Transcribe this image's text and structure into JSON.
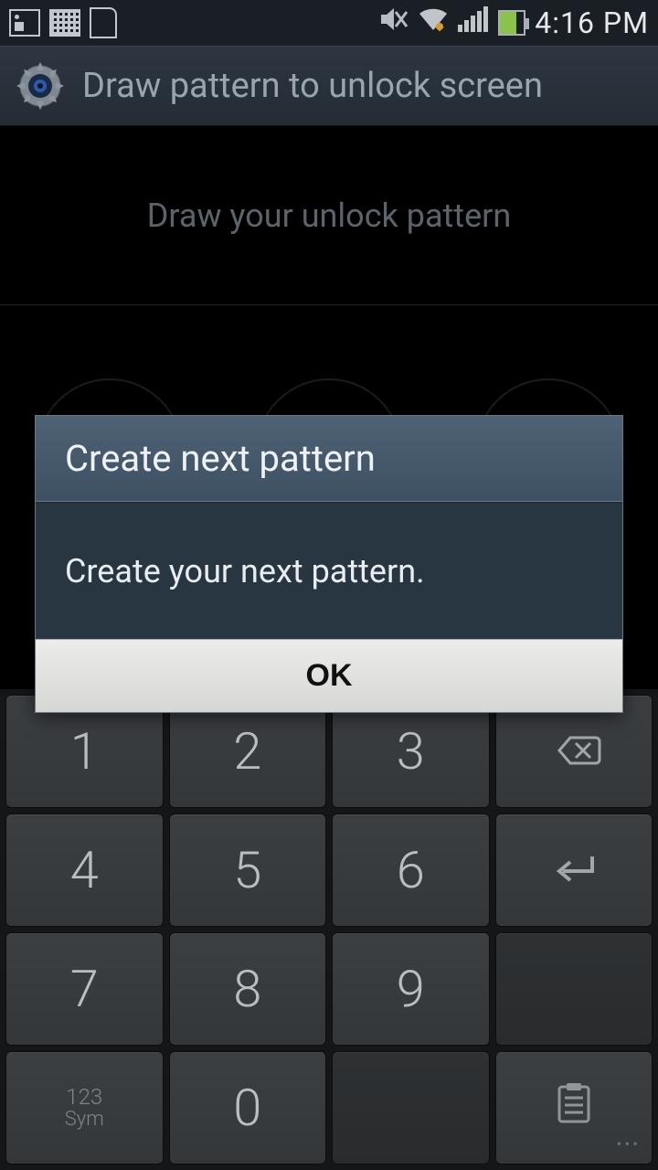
{
  "status": {
    "time": "4:16 PM"
  },
  "title": "Draw pattern to unlock screen",
  "instruction": "Draw your unlock pattern",
  "dialog": {
    "title": "Create next pattern",
    "message": "Create your next pattern.",
    "ok": "OK"
  },
  "keypad": {
    "k1": "1",
    "k2": "2",
    "k3": "3",
    "k4": "4",
    "k5": "5",
    "k6": "6",
    "k7": "7",
    "k8": "8",
    "k9": "9",
    "k0": "0",
    "sym_line1": "123",
    "sym_line2": "Sym"
  }
}
